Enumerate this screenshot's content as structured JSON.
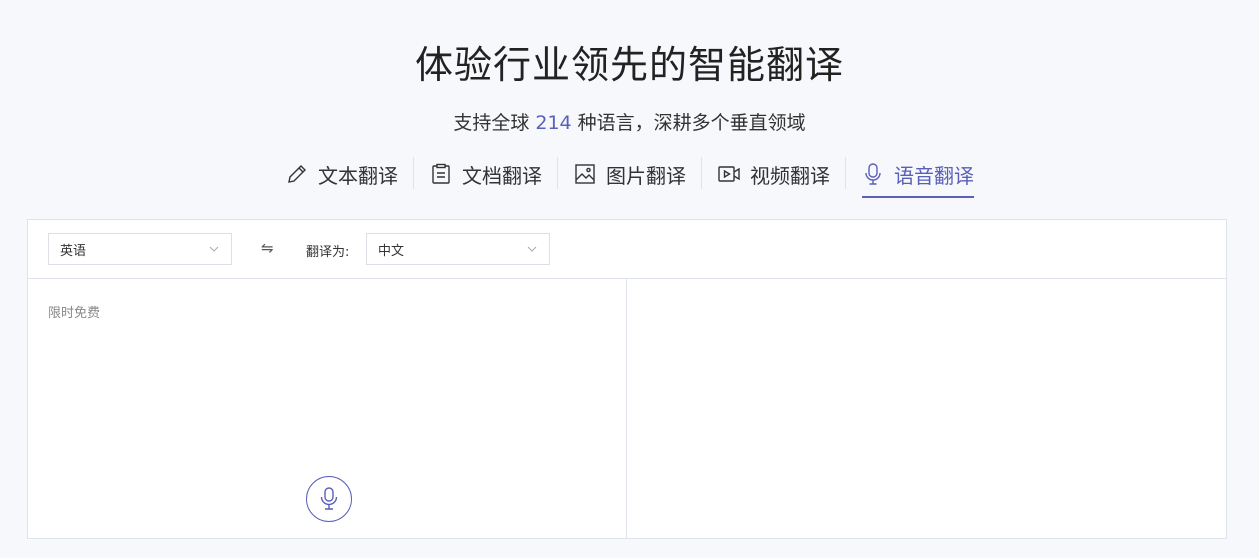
{
  "header": {
    "title": "体验行业领先的智能翻译",
    "subtitle_prefix": "支持全球 ",
    "language_count": "214",
    "subtitle_suffix": " 种语言，深耕多个垂直领域"
  },
  "tabs": [
    {
      "label": "文本翻译",
      "icon": "pencil-icon"
    },
    {
      "label": "文档翻译",
      "icon": "document-icon"
    },
    {
      "label": "图片翻译",
      "icon": "image-icon"
    },
    {
      "label": "视频翻译",
      "icon": "video-icon"
    },
    {
      "label": "语音翻译",
      "icon": "microphone-icon",
      "active": true
    }
  ],
  "toolbar": {
    "source_language": "英语",
    "swap_symbol": "⇋",
    "target_label": "翻译为:",
    "target_language": "中文"
  },
  "source_panel": {
    "hint": "限时免费"
  },
  "colors": {
    "accent": "#5a5fb8",
    "border": "#dfe3ea",
    "background": "#f6f8fb"
  }
}
